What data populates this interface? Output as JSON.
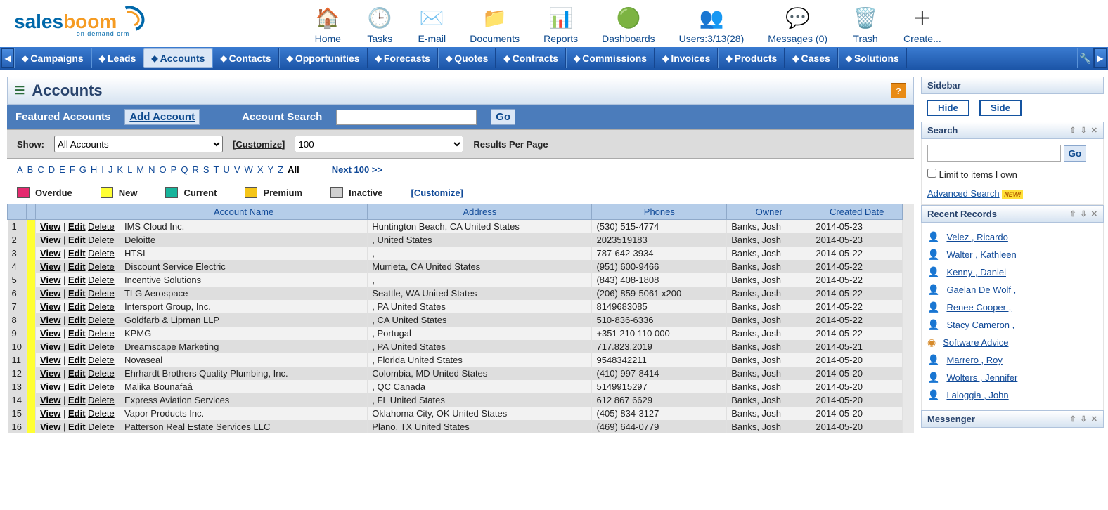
{
  "logo": {
    "p1": "sales",
    "p2": "boom",
    "tag": "on demand crm"
  },
  "top": [
    {
      "label": "Home",
      "cls": "house"
    },
    {
      "label": "Tasks",
      "cls": "clock"
    },
    {
      "label": "E-mail",
      "cls": "mail"
    },
    {
      "label": "Documents",
      "cls": "folder"
    },
    {
      "label": "Reports",
      "cls": "chart"
    },
    {
      "label": "Dashboards",
      "cls": "pie"
    },
    {
      "label": "Users:3/13(28)",
      "cls": "users"
    },
    {
      "label": "Messages (0)",
      "cls": "msg"
    },
    {
      "label": "Trash",
      "cls": "trash"
    },
    {
      "label": "Create...",
      "cls": "plus"
    }
  ],
  "nav": [
    "Campaigns",
    "Leads",
    "Accounts",
    "Contacts",
    "Opportunities",
    "Forecasts",
    "Quotes",
    "Contracts",
    "Commissions",
    "Invoices",
    "Products",
    "Cases",
    "Solutions"
  ],
  "nav_active": "Accounts",
  "page_title": "Accounts",
  "featured_label": "Featured Accounts",
  "add_account": "Add Account",
  "search_label": "Account Search",
  "go": "Go",
  "show_label": "Show:",
  "show_value": "All Accounts",
  "customize": "[Customize]",
  "perpage_value": "100",
  "rpp": "Results Per Page",
  "alpha": [
    "A",
    "B",
    "C",
    "D",
    "E",
    "F",
    "G",
    "H",
    "I",
    "J",
    "K",
    "L",
    "M",
    "N",
    "O",
    "P",
    "Q",
    "R",
    "S",
    "T",
    "U",
    "V",
    "W",
    "X",
    "Y",
    "Z"
  ],
  "all": "All",
  "next100": "Next 100 >>",
  "legend": [
    {
      "c": "#e52a6f",
      "t": "Overdue"
    },
    {
      "c": "#ffff33",
      "t": "New"
    },
    {
      "c": "#17b49b",
      "t": "Current"
    },
    {
      "c": "#f5c518",
      "t": "Premium"
    },
    {
      "c": "#d0d0d0",
      "t": "Inactive"
    }
  ],
  "legend_customize": "[Customize]",
  "actions": {
    "view": "View",
    "edit": "Edit",
    "del": "Delete"
  },
  "columns": [
    "Account Name",
    "Address",
    "Phones",
    "Owner",
    "Created Date"
  ],
  "rows": [
    {
      "n": 1,
      "name": "IMS Cloud Inc.",
      "addr": "Huntington Beach, CA United States",
      "ph": "(530) 515-4774",
      "owner": "Banks, Josh",
      "date": "2014-05-23"
    },
    {
      "n": 2,
      "name": "Deloitte",
      "addr": ", United States",
      "ph": "2023519183",
      "owner": "Banks, Josh",
      "date": "2014-05-23"
    },
    {
      "n": 3,
      "name": "HTSI",
      "addr": ",",
      "ph": "787-642-3934",
      "owner": "Banks, Josh",
      "date": "2014-05-22"
    },
    {
      "n": 4,
      "name": "Discount Service Electric",
      "addr": "Murrieta, CA United States",
      "ph": "(951) 600-9466",
      "owner": "Banks, Josh",
      "date": "2014-05-22"
    },
    {
      "n": 5,
      "name": "Incentive Solutions",
      "addr": ",",
      "ph": "(843) 408-1808",
      "owner": "Banks, Josh",
      "date": "2014-05-22"
    },
    {
      "n": 6,
      "name": "TLG Aerospace",
      "addr": "Seattle, WA United States",
      "ph": "(206) 859-5061 x200",
      "owner": "Banks, Josh",
      "date": "2014-05-22"
    },
    {
      "n": 7,
      "name": "Intersport Group, Inc.",
      "addr": ", PA United States",
      "ph": "8149683085",
      "owner": "Banks, Josh",
      "date": "2014-05-22"
    },
    {
      "n": 8,
      "name": "Goldfarb & Lipman LLP",
      "addr": ", CA United States",
      "ph": "510-836-6336",
      "owner": "Banks, Josh",
      "date": "2014-05-22"
    },
    {
      "n": 9,
      "name": "KPMG",
      "addr": ", Portugal",
      "ph": "+351 210 110 000",
      "owner": "Banks, Josh",
      "date": "2014-05-22"
    },
    {
      "n": 10,
      "name": "Dreamscape Marketing",
      "addr": ", PA United States",
      "ph": "717.823.2019",
      "owner": "Banks, Josh",
      "date": "2014-05-21"
    },
    {
      "n": 11,
      "name": "Novaseal",
      "addr": ", Florida United States",
      "ph": "9548342211",
      "owner": "Banks, Josh",
      "date": "2014-05-20"
    },
    {
      "n": 12,
      "name": "Ehrhardt Brothers Quality Plumbing, Inc.",
      "addr": "Colombia, MD United States",
      "ph": "(410) 997-8414",
      "owner": "Banks, Josh",
      "date": "2014-05-20"
    },
    {
      "n": 13,
      "name": "Malika Bounafaâ",
      "addr": ", QC Canada",
      "ph": "5149915297",
      "owner": "Banks, Josh",
      "date": "2014-05-20"
    },
    {
      "n": 14,
      "name": "Express Aviation Services",
      "addr": ", FL United States",
      "ph": "612 867 6629",
      "owner": "Banks, Josh",
      "date": "2014-05-20"
    },
    {
      "n": 15,
      "name": "Vapor Products Inc.",
      "addr": "Oklahoma City, OK United States",
      "ph": "(405) 834-3127",
      "owner": "Banks, Josh",
      "date": "2014-05-20"
    },
    {
      "n": 16,
      "name": "Patterson Real Estate Services LLC",
      "addr": "Plano, TX United States",
      "ph": "(469) 644-0779",
      "owner": "Banks, Josh",
      "date": "2014-05-20"
    }
  ],
  "sidebar": {
    "title": "Sidebar",
    "hide": "Hide",
    "side": "Side",
    "search": "Search",
    "go": "Go",
    "limit": "Limit to items I own",
    "adv": "Advanced Search",
    "new": "NEW!",
    "recent": "Recent Records",
    "records": [
      "Velez , Ricardo",
      "Walter , Kathleen",
      "Kenny , Daniel",
      "Gaelan De Wolf ,",
      "Renee Cooper ,",
      "Stacy Cameron ,",
      "Software Advice",
      "Marrero , Roy",
      "Wolters , Jennifer",
      "Laloggia , John"
    ],
    "messenger": "Messenger"
  },
  "icons_svg": {
    "house": "🏠",
    "clock": "🕒",
    "mail": "✉️",
    "folder": "📁",
    "chart": "📊",
    "pie": "🟢",
    "users": "👥",
    "msg": "💬",
    "trash": "🗑️",
    "plus": "＋"
  }
}
